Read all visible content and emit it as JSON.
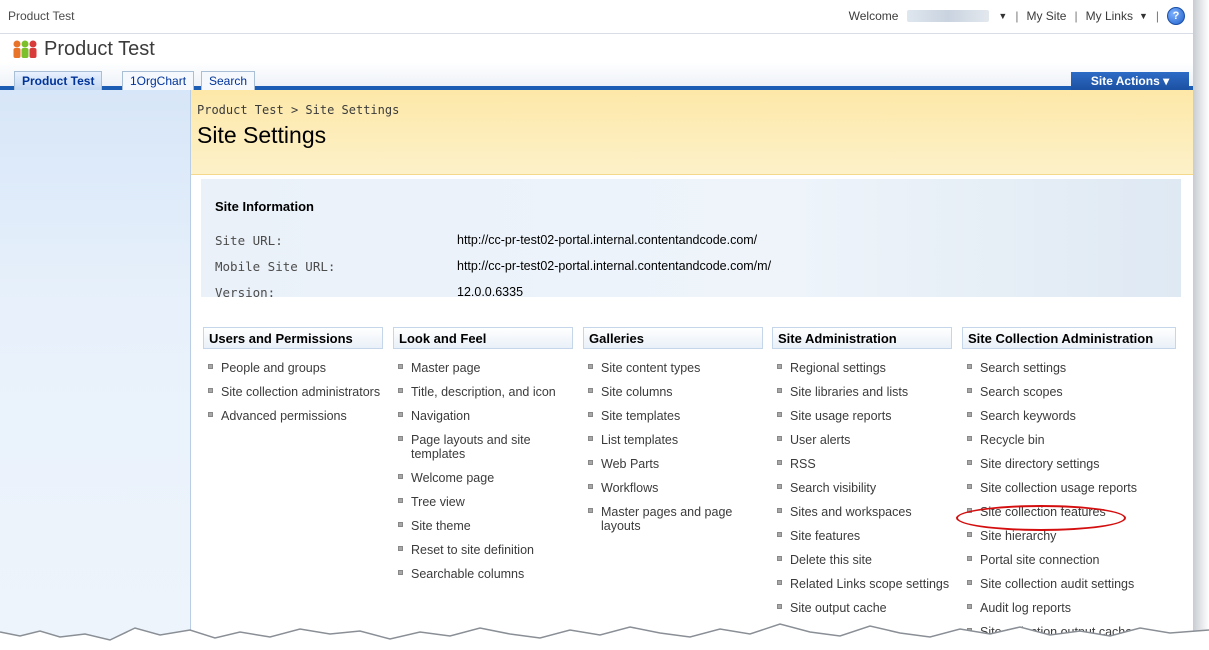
{
  "topbar": {
    "site_title": "Product Test",
    "welcome_label": "Welcome",
    "my_site": "My Site",
    "my_links": "My Links",
    "sep1": "|",
    "sep2": "|",
    "sep3": "|"
  },
  "header": {
    "site_name": "Product Test"
  },
  "tabs": [
    {
      "label": "Product Test",
      "active": true
    },
    {
      "label": "1OrgChart",
      "active": false
    },
    {
      "label": "Search",
      "active": false
    }
  ],
  "site_actions": "Site Actions ▾",
  "breadcrumb": {
    "root": "Product Test",
    "separator": ">",
    "current": "Site Settings"
  },
  "page_title": "Site Settings",
  "site_info": {
    "title": "Site Information",
    "rows": [
      {
        "label": "Site URL:",
        "value": "http://cc-pr-test02-portal.internal.contentandcode.com/"
      },
      {
        "label": "Mobile Site URL:",
        "value": "http://cc-pr-test02-portal.internal.contentandcode.com/m/"
      },
      {
        "label": "Version:",
        "value": "12.0.0.6335"
      }
    ]
  },
  "columns": [
    {
      "header": "Users and Permissions",
      "items": [
        "People and groups",
        "Site collection administrators",
        "Advanced permissions"
      ]
    },
    {
      "header": "Look and Feel",
      "items": [
        "Master page",
        "Title, description, and icon",
        "Navigation",
        "Page layouts and site templates",
        "Welcome page",
        "Tree view",
        "Site theme",
        "Reset to site definition",
        "Searchable columns"
      ]
    },
    {
      "header": "Galleries",
      "items": [
        "Site content types",
        "Site columns",
        "Site templates",
        "List templates",
        "Web Parts",
        "Workflows",
        "Master pages and page layouts"
      ]
    },
    {
      "header": "Site Administration",
      "items": [
        "Regional settings",
        "Site libraries and lists",
        "Site usage reports",
        "User alerts",
        "RSS",
        "Search visibility",
        "Sites and workspaces",
        "Site features",
        "Delete this site",
        "Related Links scope settings",
        "Site output cache"
      ]
    },
    {
      "header": "Site Collection Administration",
      "items": [
        "Search settings",
        "Search scopes",
        "Search keywords",
        "Recycle bin",
        "Site directory settings",
        "Site collection usage reports",
        "Site collection features",
        "Site hierarchy",
        "Portal site connection",
        "Site collection audit settings",
        "Audit log reports",
        "Site collection output cache"
      ]
    }
  ],
  "colors": {
    "accent": "#1c5cb3",
    "title_band": "#fde8a8",
    "highlight": "#d40e0e"
  }
}
